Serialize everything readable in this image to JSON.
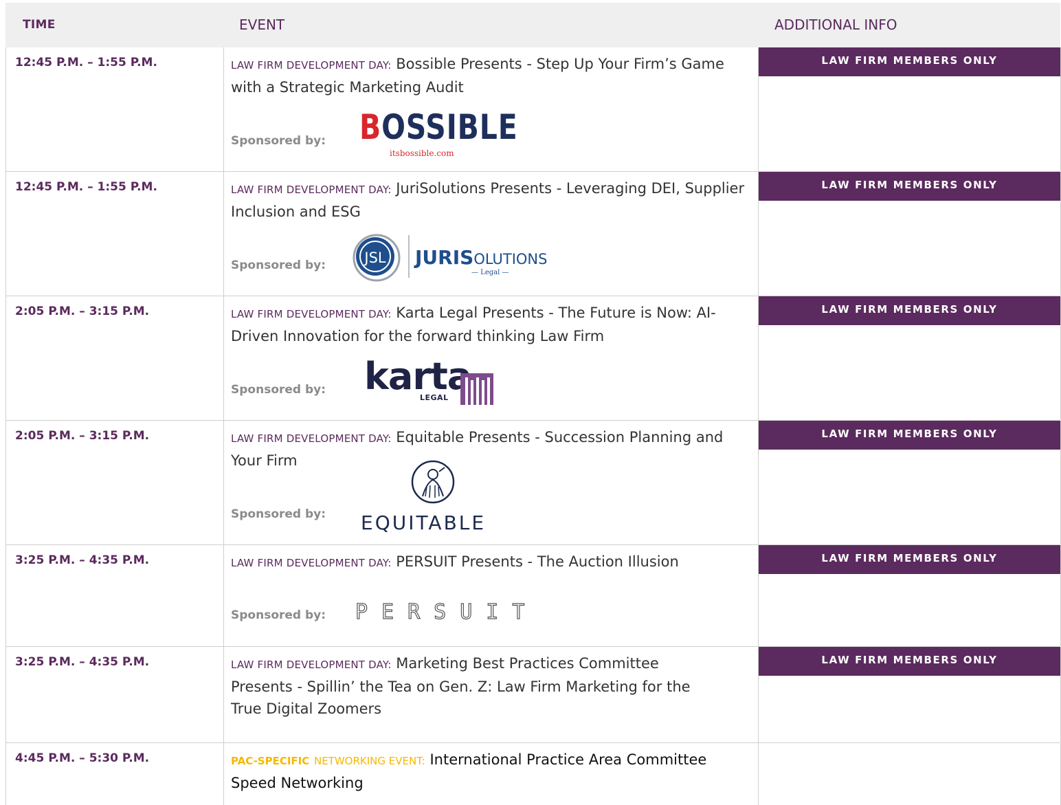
{
  "header": {
    "time": "TIME",
    "event": "EVENT",
    "info": "ADDITIONAL INFO"
  },
  "rows": [
    {
      "time": "12:45 P.M. – 1:55 P.M.",
      "tag": "LAW FIRM DEVELOPMENT DAY:",
      "title": "Bossible Presents - Step Up Your Firm’s Game with a Strategic Marketing Audit",
      "sponsor_label": "Sponsored by:",
      "logo": {
        "name": "BOSSIBLE",
        "first": "B",
        "rest": "OSSIBLE",
        "sub": "itsbossible.com"
      },
      "badge": "LAW FIRM MEMBERS ONLY"
    },
    {
      "time": "12:45 P.M. – 1:55 P.M.",
      "tag": "LAW FIRM DEVELOPMENT DAY:",
      "title": "JuriSolutions Presents - Leveraging DEI, Supplier Inclusion and ESG",
      "sponsor_label": "Sponsored by:",
      "logo": {
        "mark": "JSL",
        "big": "JURIS",
        "small": "OLUTIONS",
        "sub": "— Legal —"
      },
      "badge": "LAW FIRM MEMBERS ONLY"
    },
    {
      "time": "2:05 P.M. – 3:15 P.M.",
      "tag": "LAW FIRM DEVELOPMENT DAY:",
      "title": "Karta Legal Presents - The Future is Now: AI-Driven Innovation for the forward thinking Law Firm",
      "sponsor_label": "Sponsored by:",
      "logo": {
        "word": "karta",
        "sub": "LEGAL"
      },
      "badge": "LAW FIRM MEMBERS ONLY"
    },
    {
      "time": "2:05 P.M. – 3:15 P.M.",
      "tag": "LAW FIRM DEVELOPMENT DAY:",
      "title": "Equitable Presents - Succession Planning and Your Firm",
      "sponsor_label": "Sponsored by:",
      "logo": {
        "word": "EQUITABLE"
      },
      "badge": "LAW FIRM MEMBERS ONLY"
    },
    {
      "time": "3:25 P.M. – 4:35 P.M.",
      "tag": "LAW FIRM DEVELOPMENT DAY:",
      "title": "PERSUIT Presents - The Auction Illusion",
      "sponsor_label": "Sponsored by:",
      "logo": {
        "word": "PERSUIT"
      },
      "badge": "LAW FIRM MEMBERS ONLY"
    },
    {
      "time": "3:25 P.M. – 4:35 P.M.",
      "tag": "LAW FIRM DEVELOPMENT DAY:",
      "title": "Marketing Best Practices Committee Presents - Spillin’ the Tea on Gen. Z: Law Firm Marketing for the True Digital Zoomers",
      "badge": "LAW FIRM MEMBERS ONLY"
    },
    {
      "time": "4:45 P.M. – 5:30 P.M.",
      "tag_pac": "PAC-SPECIFIC",
      "tag_net": "NETWORKING EVENT:",
      "title": "International Practice Area Committee Speed Networking"
    }
  ],
  "colors": {
    "brand_purple": "#5b2a5e",
    "pac_yellow": "#f5b800",
    "header_bg": "#efefef"
  }
}
